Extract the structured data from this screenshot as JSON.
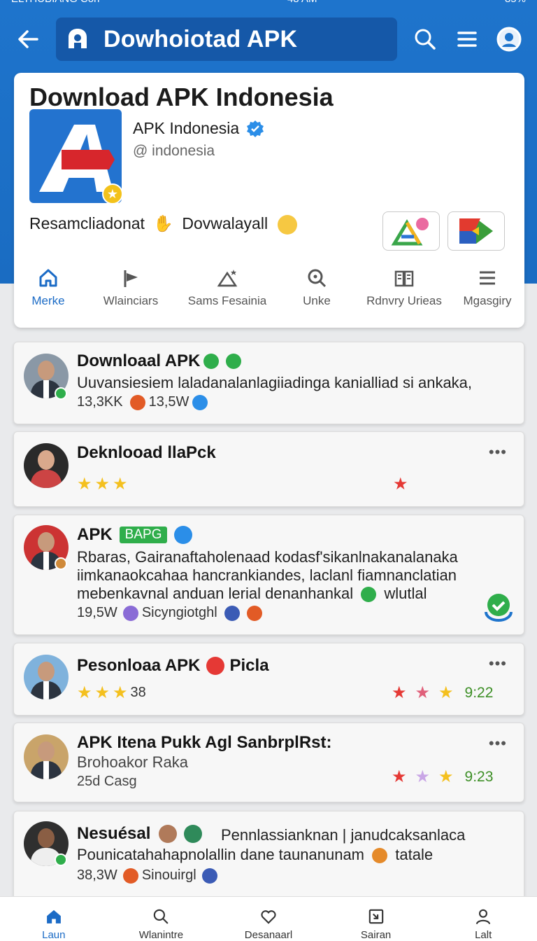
{
  "status_bar": {
    "left": "ELTHUBIANG Con",
    "time": "48 AM",
    "battery": "85%"
  },
  "header": {
    "title": "Dowhoiotad APK"
  },
  "profile": {
    "title": "Download APK Indonesia",
    "app_name": "APK Indonesia",
    "handle": "@ indonesia",
    "promo_a": "Resamcliadonat",
    "promo_b": "Dovwalayall",
    "tabs": [
      {
        "label": "Merke",
        "icon": "home-icon"
      },
      {
        "label": "Wlainciars",
        "icon": "flag-icon"
      },
      {
        "label": "Sams Fesainia",
        "icon": "camp-icon"
      },
      {
        "label": "Unke",
        "icon": "search-icon"
      },
      {
        "label": "Rdnvry Urieas",
        "icon": "book-icon"
      },
      {
        "label": "Mgasgiry",
        "icon": "menu-icon"
      }
    ]
  },
  "posts": [
    {
      "title": "Downloaal APK",
      "text": [
        "Uuvansiesiem laladanalanlagiiadinga kanialliad si ankaka,"
      ],
      "meta_a": "13,3KK",
      "meta_b": "13,5W"
    },
    {
      "title": "Deknlooad llaPck",
      "more": "•••"
    },
    {
      "title": "APK",
      "tag": "BAPG",
      "text": [
        "Rbaras, Gairanaftaholenaad kodasf'sikanlnakanalanaka",
        "iimkanaokcahaa hancrankiandes, laclanl fiamnanclatian",
        "mebenkavnal anduan lerial denanhankal"
      ],
      "text_end": "wlutlal",
      "meta_a": "19,5W",
      "meta_b": "Sicyngiotghl"
    },
    {
      "title_a": "Pesonloaa APK",
      "title_b": "Picla",
      "rating": "38",
      "time": "9:22",
      "more": "•••"
    },
    {
      "title": "APK Itena Pukk Agl SanbrplRst:",
      "subtitle": "Brohoakor Raka",
      "meta": "25d Casg",
      "time": "9:23",
      "more": "•••"
    },
    {
      "title": "Nesuésal",
      "text_a": "Pennlassianknan | janudcaksanlaca",
      "text_b": "Pounicatahahapnolallin dane taunanunam",
      "text_b_end": "tatale",
      "meta_a": "38,3W",
      "meta_b": "Sinouirgl"
    }
  ],
  "bottom_nav": [
    {
      "label": "Laun",
      "icon": "home-icon"
    },
    {
      "label": "Wlanintre",
      "icon": "search-icon"
    },
    {
      "label": "Desanaarl",
      "icon": "heart-icon"
    },
    {
      "label": "Sairan",
      "icon": "share-icon"
    },
    {
      "label": "Lalt",
      "icon": "profile-icon"
    }
  ],
  "colors": {
    "brand_blue": "#1e74cc",
    "verified_blue": "#2b8ee8",
    "success_green": "#2fae4b",
    "star_red": "#e53935",
    "star_gold": "#f4c01e"
  }
}
